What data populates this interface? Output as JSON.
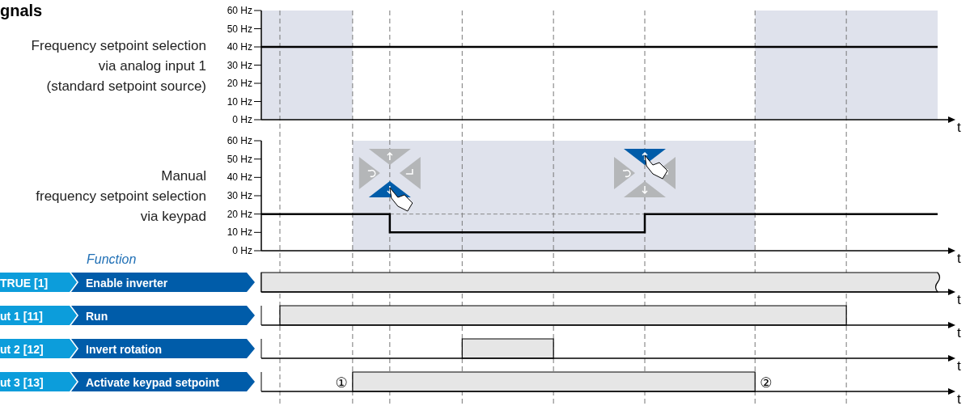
{
  "title": "gnals",
  "analog": [
    {
      "label": [
        "Frequency setpoint selection",
        "via analog input 1",
        "(standard setpoint source)"
      ],
      "yticks": [
        "60 Hz",
        "50 Hz",
        "40 Hz",
        "30 Hz",
        "20 Hz",
        "10 Hz",
        "0 Hz"
      ],
      "xlabel": "t"
    },
    {
      "label": [
        "Manual",
        "frequency setpoint selection",
        "via keypad"
      ],
      "yticks": [
        "60 Hz",
        "50 Hz",
        "40 Hz",
        "30 Hz",
        "20 Hz",
        "10 Hz",
        "0 Hz"
      ],
      "xlabel": "t"
    }
  ],
  "function_heading": "Function",
  "signals": [
    {
      "source": "TRUE [1]",
      "function": "Enable inverter",
      "xlabel": "t"
    },
    {
      "source": "ut 1 [11]",
      "function": "Run",
      "xlabel": "t"
    },
    {
      "source": "ut 2 [12]",
      "function": "Invert rotation",
      "xlabel": "t"
    },
    {
      "source": "ut 3 [13]",
      "function": "Activate keypad setpoint",
      "xlabel": "t",
      "markers": [
        "①",
        "②"
      ]
    }
  ]
}
